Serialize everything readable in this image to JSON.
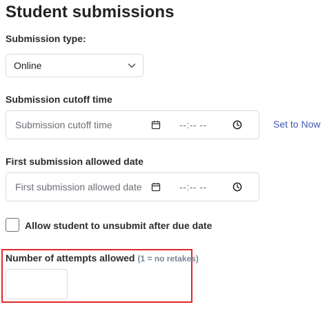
{
  "section": {
    "title": "Student submissions"
  },
  "submission_type": {
    "label": "Submission type:",
    "selected": "Online",
    "icon": "chevron-down-icon"
  },
  "cutoff": {
    "label": "Submission cutoff time",
    "placeholder": "Submission cutoff time",
    "time_placeholder": "--:-- --",
    "set_now_label": "Set to Now",
    "date_icon": "calendar-icon",
    "time_icon": "clock-icon"
  },
  "first_allowed": {
    "label": "First submission allowed date",
    "placeholder": "First submission allowed date",
    "time_placeholder": "--:-- --",
    "date_icon": "calendar-icon",
    "time_icon": "clock-icon"
  },
  "unsubmit": {
    "label": "Allow student to unsubmit after due date",
    "checked": false
  },
  "attempts": {
    "label": "Number of attempts allowed",
    "hint": "(1 = no retakes)",
    "value": ""
  },
  "colors": {
    "link": "#3f57b8",
    "highlight": "#e0262b",
    "border": "#d6d9de",
    "hint": "#7a8494"
  }
}
